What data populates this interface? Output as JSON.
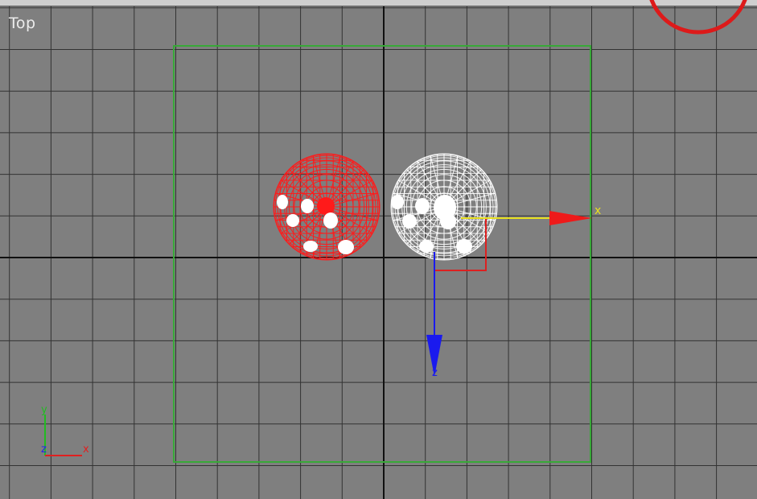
{
  "viewport": {
    "label": "Top",
    "background": "#7f7f7f",
    "grid_color": "#333333",
    "axis_line_color": "#111111",
    "safe_frame_color": "#38a838",
    "highlight_ring_color": "#dd1a1a"
  },
  "objects": [
    {
      "name": "sphere-red",
      "color": "#ff1a1a",
      "state": "unselected"
    },
    {
      "name": "sphere-white",
      "color": "#ffffff",
      "state": "selected"
    }
  ],
  "gizmo": {
    "x_label": "x",
    "z_label": "z",
    "x_color": "#e8e020",
    "z_color": "#1a1aee"
  },
  "axis_tripod": {
    "y_label": "y",
    "z_label": "z",
    "x_label": "x",
    "y_color": "#22bb22",
    "z_color": "#2222ee",
    "x_color": "#e02020"
  }
}
